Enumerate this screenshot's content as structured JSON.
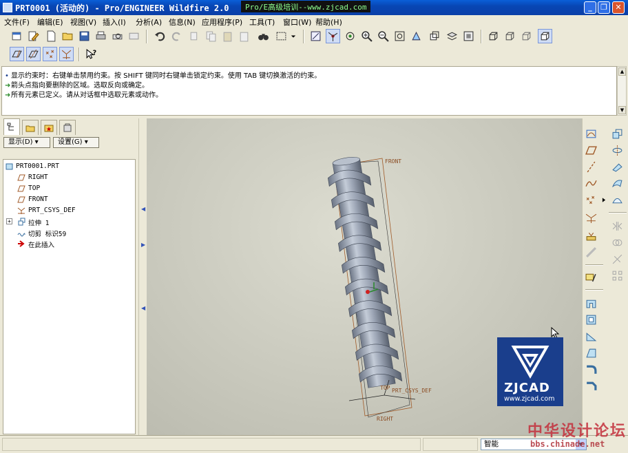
{
  "window": {
    "title": "PRT0001 (活动的) - Pro/ENGINEER Wildfire 2.0",
    "banner": "Pro/E高级培训--www.zjcad.com"
  },
  "menu": [
    "文件(F)",
    "编辑(E)",
    "视图(V)",
    "插入(I)",
    "分析(A)",
    "信息(N)",
    "应用程序(P)",
    "工具(T)",
    "窗口(W)",
    "帮助(H)"
  ],
  "messages": [
    {
      "marker": "•",
      "text": "显示约束时：右键单击禁用约束。按 SHIFT 键同时右键单击锁定约束。使用 TAB 键切换激活的约束。"
    },
    {
      "marker": "➜",
      "text": "箭头点指向要删除的区域。选取反向或确定。"
    },
    {
      "marker": "➜",
      "text": "所有元素已定义。请从对话框中选取元素或动作。"
    }
  ],
  "panel": {
    "show_button": "显示(D) ▾",
    "settings_button": "设置(G) ▾"
  },
  "tree": [
    {
      "label": "PRT0001.PRT",
      "icon": "part-icon",
      "indent": 0,
      "expander": ""
    },
    {
      "label": "RIGHT",
      "icon": "datum-plane-icon",
      "indent": 1,
      "expander": ""
    },
    {
      "label": "TOP",
      "icon": "datum-plane-icon",
      "indent": 1,
      "expander": ""
    },
    {
      "label": "FRONT",
      "icon": "datum-plane-icon",
      "indent": 1,
      "expander": ""
    },
    {
      "label": "PRT_CSYS_DEF",
      "icon": "csys-icon",
      "indent": 1,
      "expander": ""
    },
    {
      "label": "拉伸 1",
      "icon": "extrude-icon",
      "indent": 1,
      "expander": "+"
    },
    {
      "label": "切剪 标识59",
      "icon": "sweep-cut-icon",
      "indent": 1,
      "expander": ""
    },
    {
      "label": "在此插入",
      "icon": "insert-here-arrow-icon",
      "indent": 1,
      "expander": ""
    }
  ],
  "graphics": {
    "labels": {
      "front": "FRONT",
      "top": "TOP",
      "csys": "PRT_CSYS_DEF",
      "right": "RIGHT"
    },
    "logo": {
      "name": "ZJCAD",
      "url": "www.zjcad.com"
    },
    "colors": {
      "background": "#c9c9bd",
      "model": "#9ba4b4",
      "datum": "#a05a28"
    }
  },
  "status": {
    "filter": "智能"
  },
  "watermark": {
    "title": "中华设计论坛",
    "url": "bbs.chinade.net"
  }
}
